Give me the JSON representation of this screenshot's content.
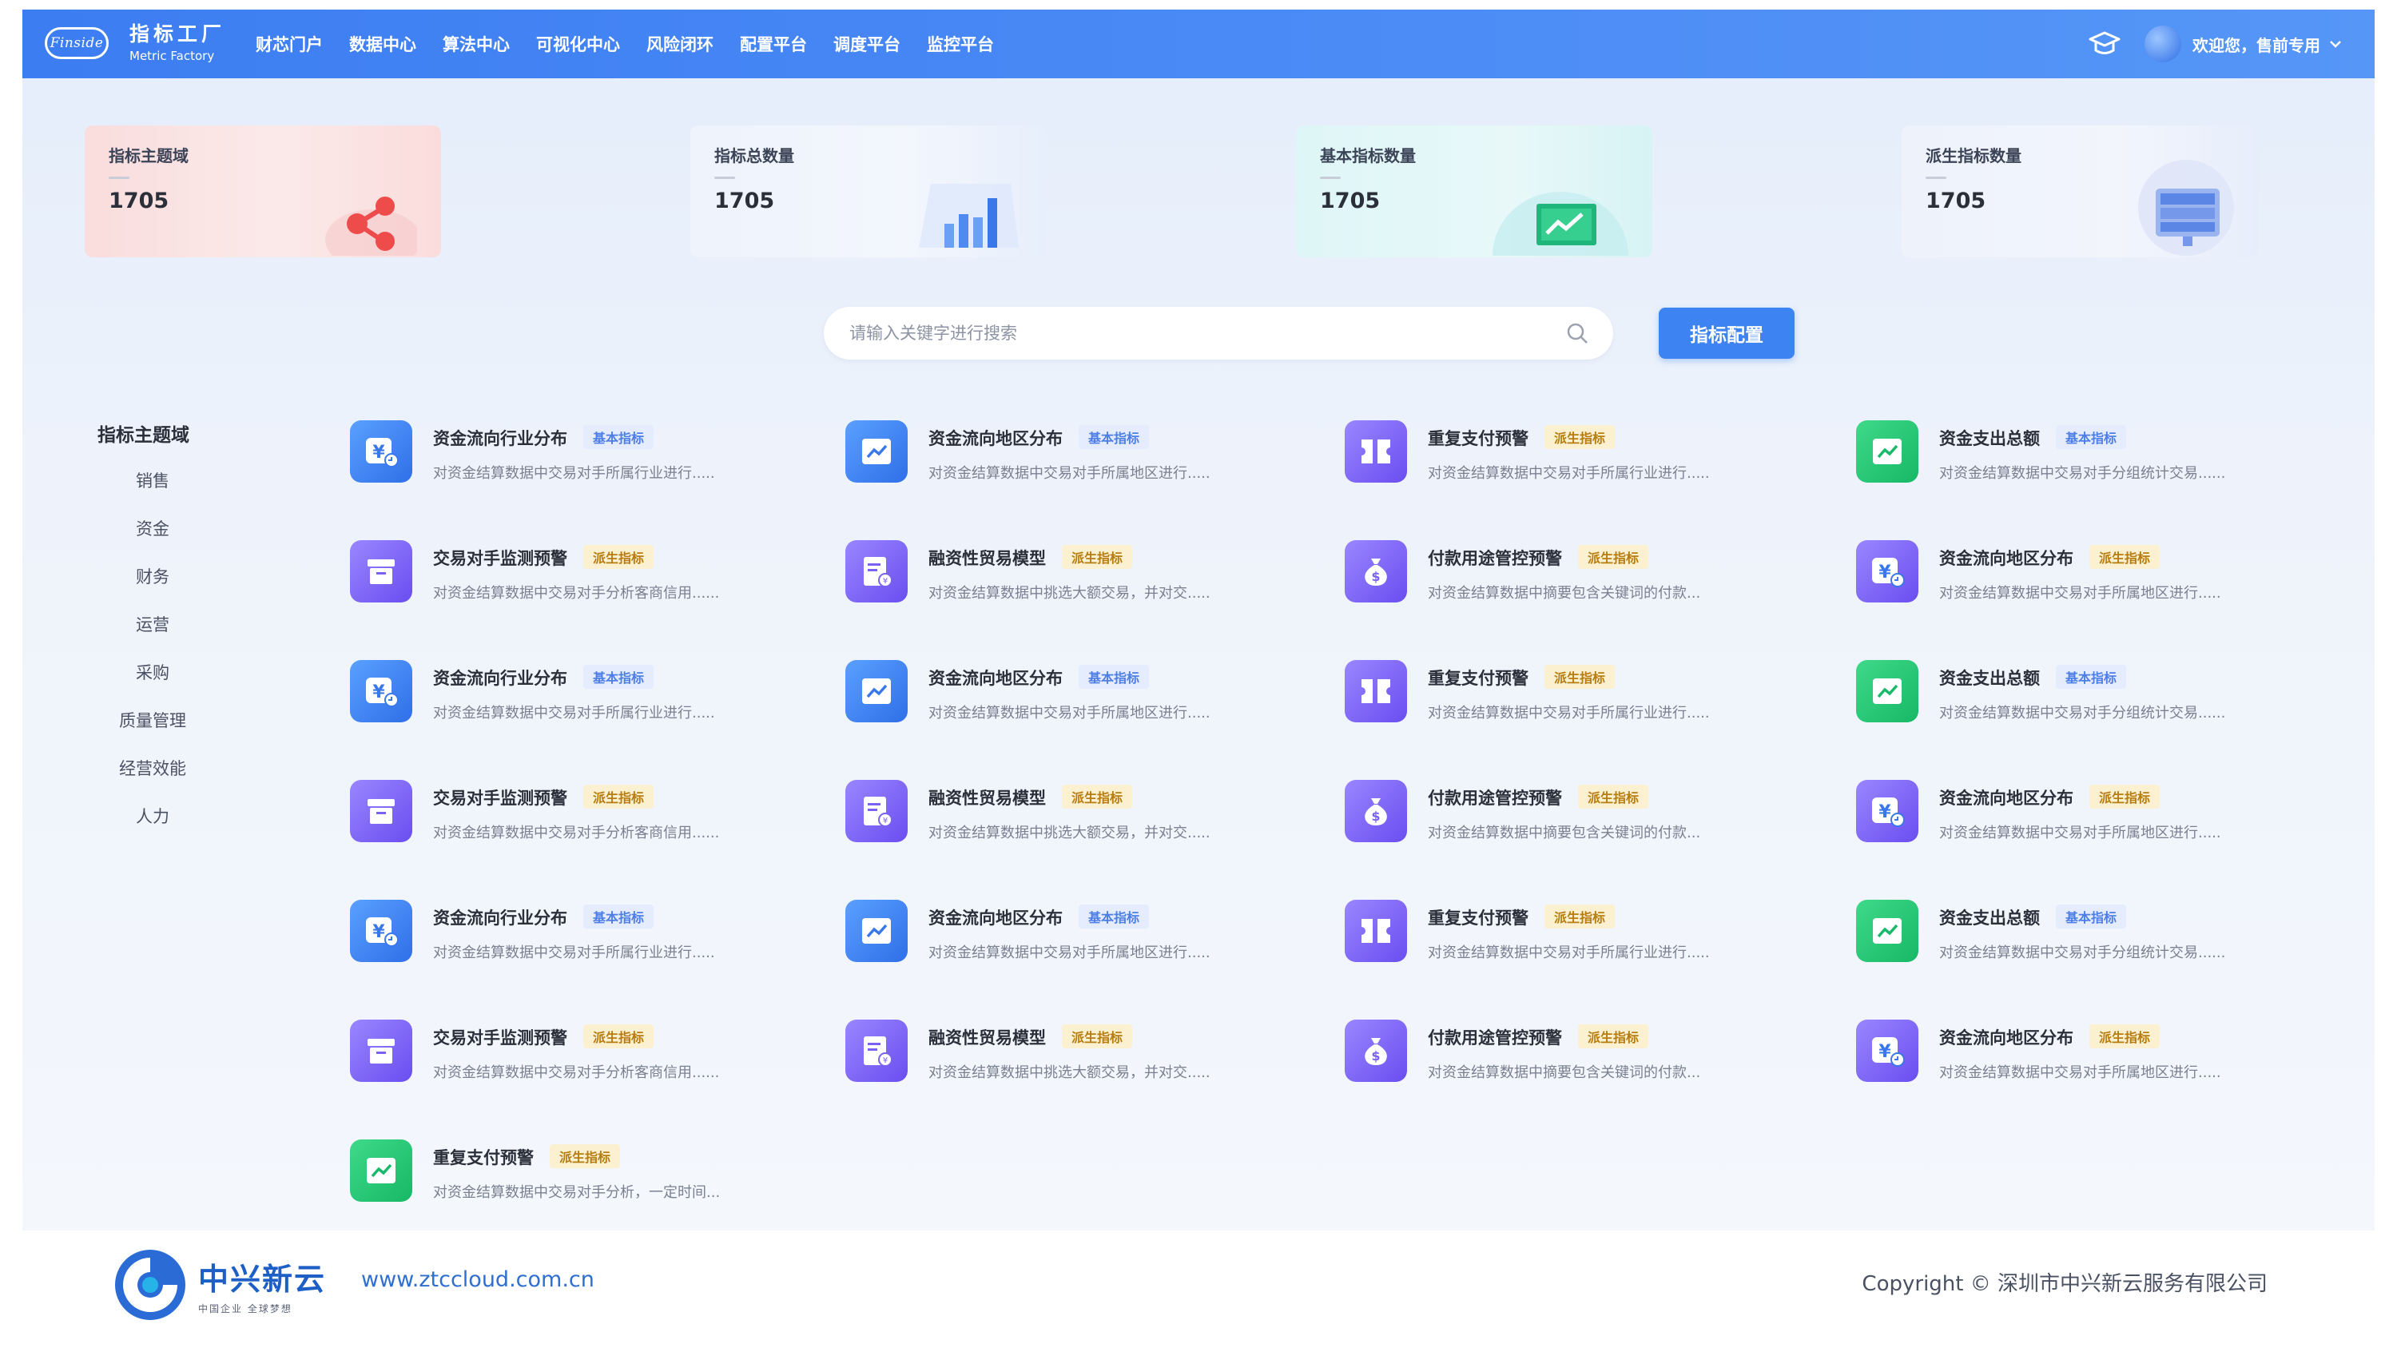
{
  "header": {
    "logo_text": "Finside",
    "brand_cn": "指标工厂",
    "brand_en": "Metric Factory",
    "nav": [
      "财芯门户",
      "数据中心",
      "算法中心",
      "可视化中心",
      "风险闭环",
      "配置平台",
      "调度平台",
      "监控平台"
    ],
    "welcome": "欢迎您，售前专用"
  },
  "cards": [
    {
      "title": "指标主题域",
      "value": "1705",
      "icon": "share-nodes-icon"
    },
    {
      "title": "指标总数量",
      "value": "1705",
      "icon": "bar-chart-icon"
    },
    {
      "title": "基本指标数量",
      "value": "1705",
      "icon": "trend-monitor-icon"
    },
    {
      "title": "派生指标数量",
      "value": "1705",
      "icon": "server-rack-icon"
    }
  ],
  "search": {
    "placeholder": "请输入关键字进行搜索"
  },
  "config_button": "指标配置",
  "sidebar": {
    "title": "指标主题域",
    "items": [
      "销售",
      "资金",
      "财务",
      "运营",
      "采购",
      "质量管理",
      "经营效能",
      "人力"
    ]
  },
  "metrics": [
    {
      "title": "资金流向行业分布",
      "tag": "基本指标",
      "desc": "对资金结算数据中交易对手所属行业进行.....",
      "icon": "yuan-icon",
      "color": "blue"
    },
    {
      "title": "资金流向地区分布",
      "tag": "基本指标",
      "desc": "对资金结算数据中交易对手所属地区进行.....",
      "icon": "trend-icon",
      "color": "blue"
    },
    {
      "title": "重复支付预警",
      "tag": "派生指标",
      "desc": "对资金结算数据中交易对手所属行业进行.....",
      "icon": "ticket-icon",
      "color": "purple"
    },
    {
      "title": "资金支出总额",
      "tag": "基本指标",
      "desc": "对资金结算数据中交易对手分组统计交易......",
      "icon": "trend-icon",
      "color": "green"
    },
    {
      "title": "交易对手监测预警",
      "tag": "派生指标",
      "desc": "对资金结算数据中交易对手分析客商信用......",
      "icon": "archive-icon",
      "color": "purple"
    },
    {
      "title": "融资性贸易模型",
      "tag": "派生指标",
      "desc": "对资金结算数据中挑选大额交易，并对交.....",
      "icon": "invoice-icon",
      "color": "purple"
    },
    {
      "title": "付款用途管控预警",
      "tag": "派生指标",
      "desc": "对资金结算数据中摘要包含关键词的付款...",
      "icon": "money-bag-icon",
      "color": "purple"
    },
    {
      "title": "资金流向地区分布",
      "tag": "派生指标",
      "desc": "对资金结算数据中交易对手所属地区进行.....",
      "icon": "yuan-icon",
      "color": "purple"
    },
    {
      "title": "资金流向行业分布",
      "tag": "基本指标",
      "desc": "对资金结算数据中交易对手所属行业进行.....",
      "icon": "yuan-icon",
      "color": "blue"
    },
    {
      "title": "资金流向地区分布",
      "tag": "基本指标",
      "desc": "对资金结算数据中交易对手所属地区进行.....",
      "icon": "trend-icon",
      "color": "blue"
    },
    {
      "title": "重复支付预警",
      "tag": "派生指标",
      "desc": "对资金结算数据中交易对手所属行业进行.....",
      "icon": "ticket-icon",
      "color": "purple"
    },
    {
      "title": "资金支出总额",
      "tag": "基本指标",
      "desc": "对资金结算数据中交易对手分组统计交易......",
      "icon": "trend-icon",
      "color": "green"
    },
    {
      "title": "交易对手监测预警",
      "tag": "派生指标",
      "desc": "对资金结算数据中交易对手分析客商信用......",
      "icon": "archive-icon",
      "color": "purple"
    },
    {
      "title": "融资性贸易模型",
      "tag": "派生指标",
      "desc": "对资金结算数据中挑选大额交易，并对交.....",
      "icon": "invoice-icon",
      "color": "purple"
    },
    {
      "title": "付款用途管控预警",
      "tag": "派生指标",
      "desc": "对资金结算数据中摘要包含关键词的付款...",
      "icon": "money-bag-icon",
      "color": "purple"
    },
    {
      "title": "资金流向地区分布",
      "tag": "派生指标",
      "desc": "对资金结算数据中交易对手所属地区进行.....",
      "icon": "yuan-icon",
      "color": "purple"
    },
    {
      "title": "资金流向行业分布",
      "tag": "基本指标",
      "desc": "对资金结算数据中交易对手所属行业进行.....",
      "icon": "yuan-icon",
      "color": "blue"
    },
    {
      "title": "资金流向地区分布",
      "tag": "基本指标",
      "desc": "对资金结算数据中交易对手所属地区进行.....",
      "icon": "trend-icon",
      "color": "blue"
    },
    {
      "title": "重复支付预警",
      "tag": "派生指标",
      "desc": "对资金结算数据中交易对手所属行业进行.....",
      "icon": "ticket-icon",
      "color": "purple"
    },
    {
      "title": "资金支出总额",
      "tag": "基本指标",
      "desc": "对资金结算数据中交易对手分组统计交易......",
      "icon": "trend-icon",
      "color": "green"
    },
    {
      "title": "交易对手监测预警",
      "tag": "派生指标",
      "desc": "对资金结算数据中交易对手分析客商信用......",
      "icon": "archive-icon",
      "color": "purple"
    },
    {
      "title": "融资性贸易模型",
      "tag": "派生指标",
      "desc": "对资金结算数据中挑选大额交易，并对交.....",
      "icon": "invoice-icon",
      "color": "purple"
    },
    {
      "title": "付款用途管控预警",
      "tag": "派生指标",
      "desc": "对资金结算数据中摘要包含关键词的付款...",
      "icon": "money-bag-icon",
      "color": "purple"
    },
    {
      "title": "资金流向地区分布",
      "tag": "派生指标",
      "desc": "对资金结算数据中交易对手所属地区进行.....",
      "icon": "yuan-icon",
      "color": "purple"
    },
    {
      "title": "重复支付预警",
      "tag": "派生指标",
      "desc": "对资金结算数据中交易对手分析，一定时间...",
      "icon": "trend-icon",
      "color": "green"
    }
  ],
  "footer": {
    "logo_cn": "中兴新云",
    "logo_sub": "中国企业 全球梦想",
    "url": "www.ztccloud.com.cn",
    "copyright": "Copyright © 深圳市中兴新云服务有限公司"
  },
  "colors": {
    "header": "#3c7df2",
    "accent": "#3d84f2",
    "basic_tag": "#4d7de6",
    "derived_tag": "#b77c10"
  }
}
